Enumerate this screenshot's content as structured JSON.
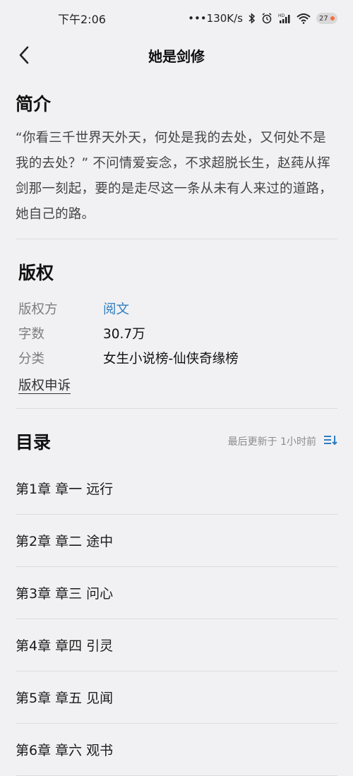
{
  "status": {
    "time": "下午2:06",
    "net_speed": "•••130K/s",
    "battery": "27"
  },
  "nav": {
    "title": "她是剑修"
  },
  "intro": {
    "heading": "简介",
    "text": "“你看三千世界天外天，何处是我的去处，又何处不是我的去处？” 不问情爱妄念，不求超脱长生，赵莼从挥剑那一刻起，要的是走尽这一条从未有人来过的道路，她自己的路。"
  },
  "copyright": {
    "heading": "版权",
    "items": [
      {
        "key": "版权方",
        "value": "阅文"
      },
      {
        "key": "字数",
        "value": "30.7万"
      },
      {
        "key": "分类",
        "value": "女生小说榜-仙侠奇缘榜"
      }
    ],
    "complaint_label": "版权申诉"
  },
  "toc": {
    "heading": "目录",
    "updated": "最后更新于 1小时前",
    "chapters": [
      "第1章 章一 远行",
      "第2章 章二 途中",
      "第3章 章三 问心",
      "第4章 章四 引灵",
      "第5章 章五 见闻",
      "第6章 章六 观书"
    ]
  },
  "colors": {
    "link": "#2f7dbf",
    "background": "#f1f1f3",
    "sort_icon": "#2f7dbf"
  }
}
